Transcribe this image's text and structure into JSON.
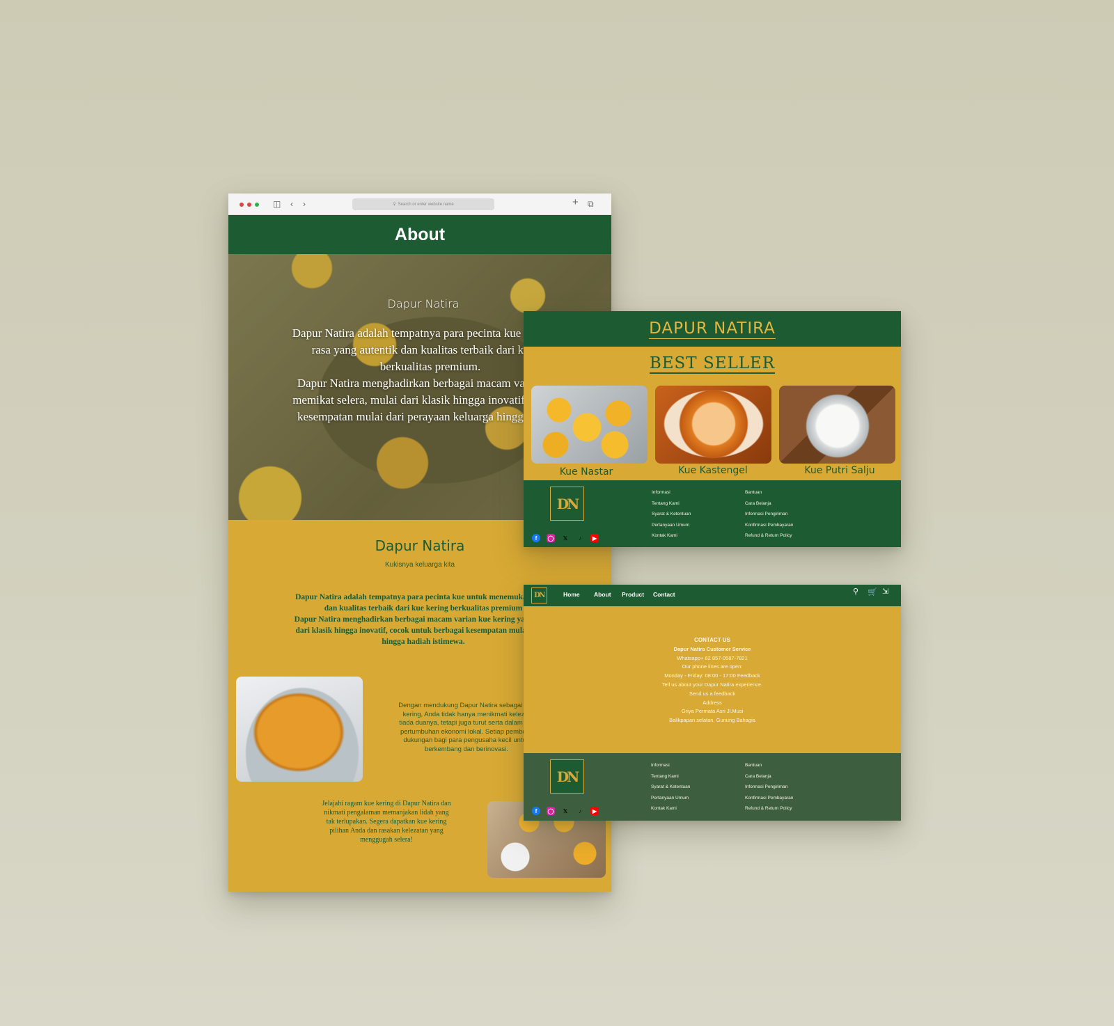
{
  "about_page": {
    "url_placeholder": "Search or enter website name",
    "header_title": "About",
    "hero": {
      "title": "Dapur Natira",
      "text": "Dapur Natira adalah tempatnya para pecinta kue untuk me\nrasa yang autentik dan kualitas terbaik dari kue ke\nberkualitas premium.\nDapur Natira menghadirkan berbagai macam varian kue\nmemikat selera, mulai dari klasik hingga inovatif, cocok u\nkesempatan mulai dari perayaan keluarga hingga hadiah"
    },
    "section_title": "Dapur Natira",
    "section_subtitle": "Kukisnya keluarga kita",
    "section_text": "Dapur Natira adalah tempatnya para pecinta kue untuk menemukan cita r\ndan kualitas terbaik dari kue kering berkualitas premium\nDapur Natira menghadirkan berbagai macam varian kue kering yang mem\ndari klasik hingga inovatif, cocok untuk berbagai kesempatan mulai dari p\nhingga hadiah istimewa.",
    "paragraph_1": "Dengan mendukung Dapur Natira sebagai UM\nkering, Anda tidak hanya menikmati kelezat\ntiada duanya, tetapi juga turut serta dalam me\npertumbuhan ekonomi lokal. Setiap pembelia\ndukungan bagi para pengusaha kecil untuk\nberkembang dan berinovasi.",
    "paragraph_2": "Jelajahi ragam kue kering di Dapur Natira dan\nnikmati pengalaman memanjakan lidah yang\ntak terlupakan. Segera dapatkan kue kering\npilihan Anda dan rasakan kelezatan yang\nmenggugah selera!"
  },
  "best_seller_page": {
    "brand": "DAPUR NATIRA",
    "title": "BEST SELLER",
    "products": [
      {
        "name": "Kue Nastar"
      },
      {
        "name": "Kue Kastengel"
      },
      {
        "name": "Kue Putri Salju"
      }
    ]
  },
  "footer": {
    "logo_text": "DN",
    "col1": [
      "Informasi",
      "Tentang Kami",
      "Syarat & Ketentuan",
      "Pertanyaan Umum",
      "Kontak Kami"
    ],
    "col2": [
      "Bantuan",
      "Cara Belanja",
      "Informasi Pengiriman",
      "Konfirmasi Pembayaran",
      "Refund & Return Policy"
    ],
    "social_icons": [
      "facebook-icon",
      "instagram-icon",
      "x-icon",
      "tiktok-icon",
      "youtube-icon"
    ]
  },
  "contact_page": {
    "nav": [
      "Home",
      "About",
      "Product",
      "Contact"
    ],
    "heading": "CONTACT US",
    "lines": [
      "Dapur Natira Customer Service",
      "Whatsapp+ 62 857-0587-7821",
      "Our phone lines are open:",
      "Monday - Friday: 08:00 - 17:00  Feedback",
      "Tell us about your Dapur Natira experience.",
      "Send us a feedback",
      "Address",
      "Griya Permata Asri Jl.Musi",
      "Balikpapan selatan, Gunung Bahagia"
    ]
  },
  "colors": {
    "green": "#1d5b32",
    "mustard": "#d8a934",
    "gold": "#e5b53e",
    "muted_green": "#3e5f3f"
  }
}
